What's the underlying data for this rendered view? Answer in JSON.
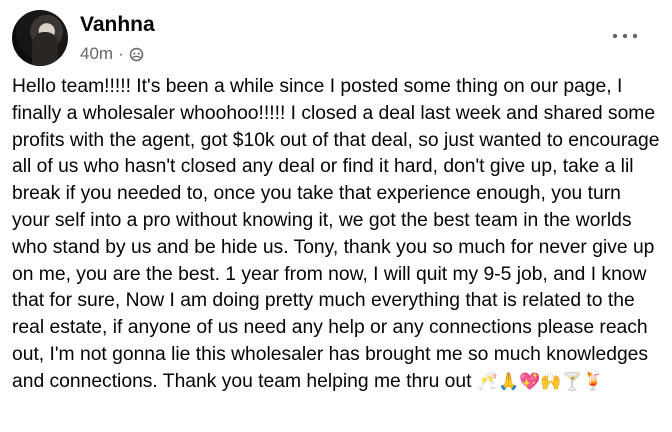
{
  "post": {
    "author_name": "Vanhna",
    "timestamp": "40m",
    "separator": "·",
    "audience_icon": "globe-friends-icon",
    "more_icon": "ellipsis-icon",
    "body_text": "Hello team!!!!! It's been a while since I posted some thing on our page, I finally a wholesaler whoohoo!!!!! I closed a deal last week and shared some profits with the agent, got $10k out of that deal, so just wanted to encourage all of us who hasn't closed any deal or find it hard, don't give up, take a lil break if you needed to, once you take that experience enough, you turn your self into a pro without knowing it, we got the best team in the worlds who stand by us and be hide us. Tony, thank you so much for never give up on me, you are the best. 1 year from now, I will quit my 9-5 job, and I know that for sure, Now I am doing pretty much everything that is related to the real estate, if anyone of us need any help or any connections please reach out, I'm not gonna lie this wholesaler has brought me so much knowledges and connections. Thank you team helping me thru out",
    "emoji_text": "🥂🙏💖🙌🍸🍹"
  }
}
